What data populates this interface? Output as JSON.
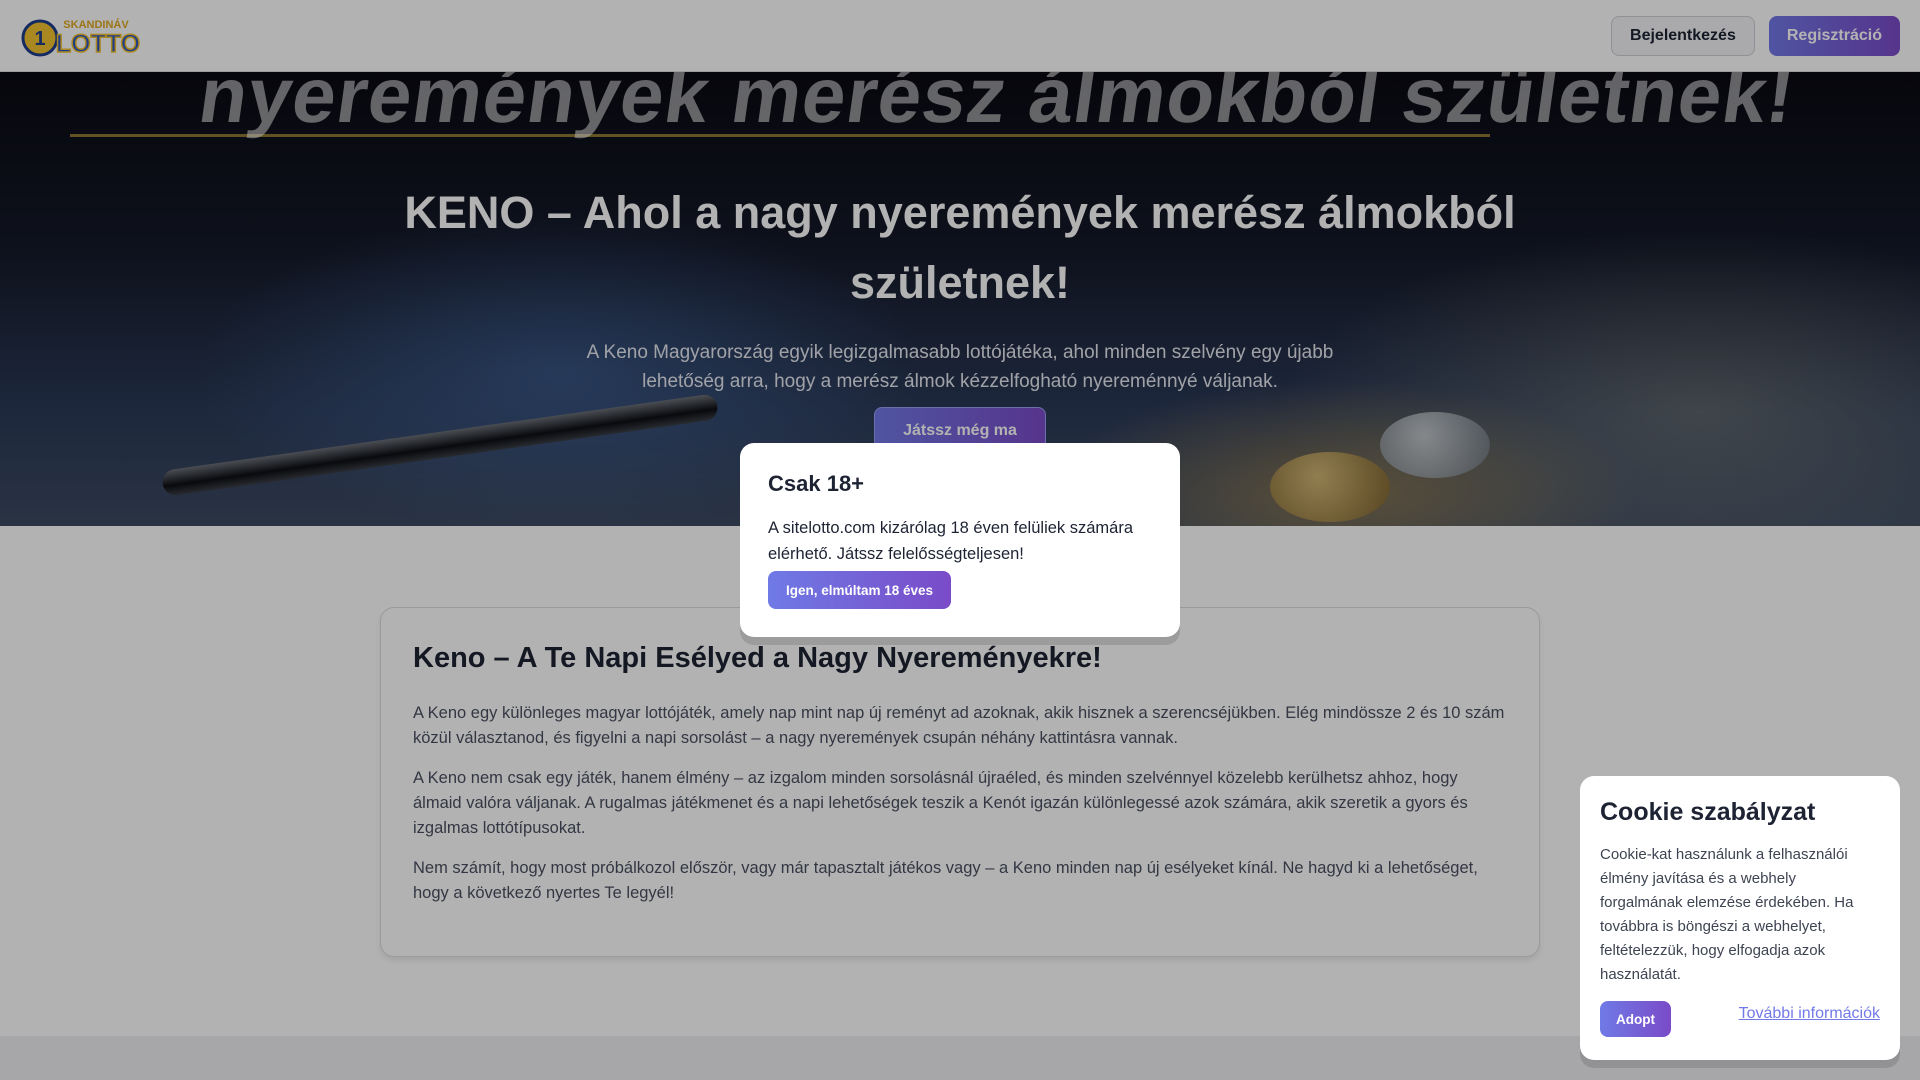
{
  "header": {
    "logo_text_top": "SKANDINÁV",
    "logo_text_main": "LOTTO",
    "logo_badge": "1",
    "login_label": "Bejelentkezés",
    "register_label": "Regisztráció"
  },
  "hero": {
    "background_text": "nyeremények merész álmokból születnek!",
    "title": "KENO – Ahol a nagy nyeremények merész álmokból születnek!",
    "description": "A Keno Magyarország egyik legizgalmasabb lottójátéka, ahol minden szelvény egy újabb lehetőség arra, hogy a merész álmok kézzelfogható nyereménnyé váljanak.",
    "cta_label": "Játssz még ma"
  },
  "content": {
    "heading": "Keno – A Te Napi Esélyed a Nagy Nyereményekre!",
    "paragraphs": [
      "A Keno egy különleges magyar lottójáték, amely nap mint nap új reményt ad azoknak, akik hisznek a szerencséjükben. Elég mindössze 2 és 10 szám közül választanod, és figyelni a napi sorsolást – a nagy nyeremények csupán néhány kattintásra vannak.",
      "A Keno nem csak egy játék, hanem élmény – az izgalom minden sorsolásnál újraéled, és minden szelvénnyel közelebb kerülhetsz ahhoz, hogy álmaid valóra váljanak. A rugalmas játékmenet és a napi lehetőségek teszik a Kenót igazán különlegessé azok számára, akik szeretik a gyors és izgalmas lottótípusokat.",
      "Nem számít, hogy most próbálkozol először, vagy már tapasztalt játékos vagy – a Keno minden nap új esélyeket kínál. Ne hagyd ki a lehetőséget, hogy a következő nyertes Te legyél!"
    ]
  },
  "age_modal": {
    "title": "Csak 18+",
    "text": "A sitelotto.com kizárólag 18 éven felüliek számára elérhető. Játssz felelősségteljesen!",
    "confirm_label": "Igen, elmúltam 18 éves"
  },
  "cookie": {
    "title": "Cookie szabályzat",
    "text": "Cookie-kat használunk a felhasználói élmény javítása és a webhely forgalmának elemzése érdekében. Ha továbbra is böngészi a webhelyet, feltételezzük, hogy elfogadja azok használatát.",
    "accept_label": "Adopt",
    "more_label": "További információk"
  },
  "colors": {
    "accent_start": "#7279e8",
    "accent_end": "#7b4cc9",
    "text_dark": "#1d2333",
    "overlay": "rgba(0,0,0,0.3)"
  }
}
